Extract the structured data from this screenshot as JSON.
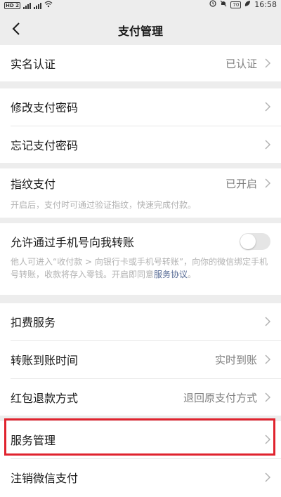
{
  "status_bar": {
    "left": "HD 2",
    "battery": "70",
    "time": "16:58"
  },
  "header": {
    "title": "支付管理"
  },
  "rows": {
    "real_name": {
      "label": "实名认证",
      "value": "已认证"
    },
    "change_pwd": {
      "label": "修改支付密码"
    },
    "forgot_pwd": {
      "label": "忘记支付密码"
    },
    "fingerprint": {
      "label": "指纹支付",
      "value": "已开启",
      "note": "开启后，支付时可通过验证指纹，快速完成付款。"
    },
    "phone_transfer": {
      "label": "允许通过手机号向我转账",
      "toggle_on": false,
      "note": "他人可进入“收付款 > 向银行卡或手机号转账”，向你的微信绑定手机号转账，收款将存入零钱。开启即同意",
      "note_link": "服务协议",
      "note_end": "。"
    },
    "deduction": {
      "label": "扣费服务"
    },
    "arrival_time": {
      "label": "转账到账时间",
      "value": "实时到账"
    },
    "red_packet_refund": {
      "label": "红包退款方式",
      "value": "退回原支付方式"
    },
    "service_mgmt": {
      "label": "服务管理"
    },
    "cancel_pay": {
      "label": "注销微信支付"
    }
  },
  "colors": {
    "highlight": "#e0232e",
    "link": "#576b95"
  }
}
